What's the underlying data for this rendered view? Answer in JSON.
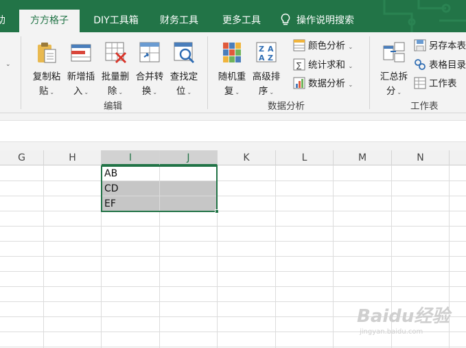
{
  "tabs": [
    {
      "label": "助",
      "active": false
    },
    {
      "label": "方方格子",
      "active": true
    },
    {
      "label": "DIY工具箱",
      "active": false
    },
    {
      "label": "财务工具",
      "active": false
    },
    {
      "label": "更多工具",
      "active": false
    },
    {
      "label": "操作说明搜索",
      "active": false,
      "icon": "lightbulb-icon"
    }
  ],
  "ribbon": {
    "edit_group": {
      "label": "编辑",
      "buttons": [
        {
          "line1": "复制粘",
          "line2": "贴",
          "icon": "copy-paste-icon"
        },
        {
          "line1": "新增插",
          "line2": "入",
          "icon": "insert-icon"
        },
        {
          "line1": "批量删",
          "line2": "除",
          "icon": "batch-delete-icon"
        },
        {
          "line1": "合并转",
          "line2": "换",
          "icon": "merge-convert-icon"
        },
        {
          "line1": "查找定",
          "line2": "位",
          "icon": "find-locate-icon"
        }
      ]
    },
    "analysis_group": {
      "label": "数据分析",
      "buttons": [
        {
          "line1": "随机重",
          "line2": "复",
          "icon": "random-repeat-icon"
        },
        {
          "line1": "高级排",
          "line2": "序",
          "icon": "advanced-sort-icon"
        }
      ],
      "small_buttons": [
        {
          "label": "颜色分析",
          "icon": "color-analysis-icon"
        },
        {
          "label": "统计求和",
          "icon": "stat-sum-icon"
        },
        {
          "label": "数据分析",
          "icon": "data-analysis-icon"
        }
      ]
    },
    "sheet_group": {
      "label": "工作表",
      "button": {
        "line1": "汇总拆",
        "line2": "分",
        "icon": "summary-split-icon"
      },
      "small_buttons": [
        {
          "label": "另存本表",
          "icon": "save-sheet-icon"
        },
        {
          "label": "表格目录",
          "icon": "table-directory-icon"
        },
        {
          "label": "工作表",
          "icon": "worksheet-icon"
        }
      ]
    }
  },
  "grid": {
    "columns": [
      "G",
      "H",
      "I",
      "J",
      "K",
      "L",
      "M",
      "N"
    ],
    "selected_columns": [
      "I",
      "J"
    ],
    "cells": [
      {
        "ref": "I1",
        "value": "AB"
      },
      {
        "ref": "I2",
        "value": "CD"
      },
      {
        "ref": "I3",
        "value": "EF"
      }
    ]
  },
  "watermark": {
    "main": "Baidu经验",
    "sub": "jingyan.baidu.com"
  },
  "colors": {
    "accent": "#227447",
    "selection": "#217346",
    "shaded": "#c6c6c6"
  }
}
